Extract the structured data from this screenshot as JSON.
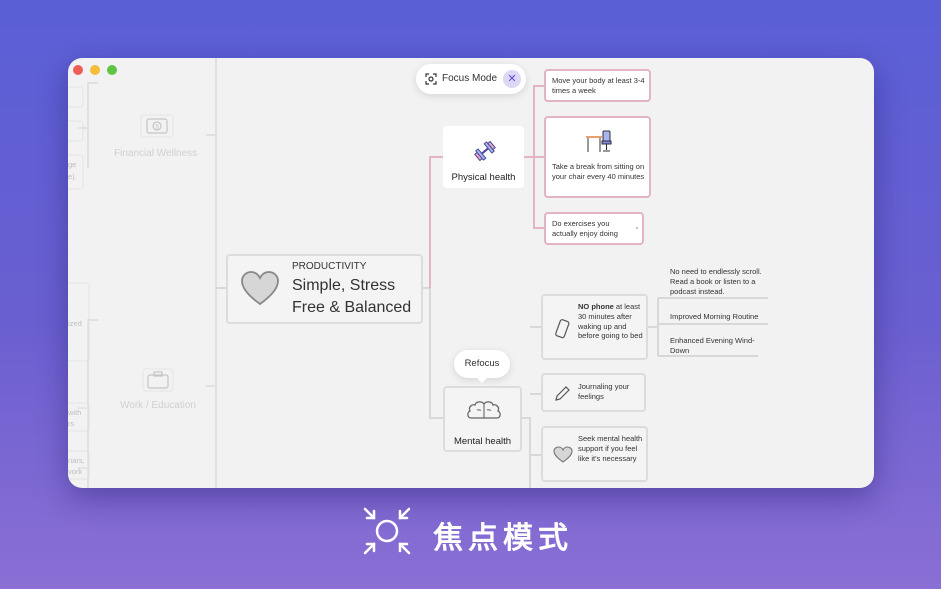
{
  "caption": {
    "text": "焦点模式",
    "icon": "focus-target-icon"
  },
  "focus_mode": {
    "label": "Focus Mode",
    "close": "✕",
    "icon": "focus-icon"
  },
  "refocus": {
    "label": "Refocus"
  },
  "left_branches": [
    {
      "label": "Financial Wellness",
      "icon": "money-icon"
    },
    {
      "label": "Work / Education",
      "icon": "briefcase-icon"
    }
  ],
  "left_snippets": [
    "ge",
    "e).",
    "ized",
    "with",
    "rs",
    "nars,",
    "vork"
  ],
  "central": {
    "category": "PRODUCTIVITY",
    "title_line1": "Simple, Stress",
    "title_line2": "Free & Balanced",
    "icon": "heart-icon"
  },
  "physical": {
    "label": "Physical health",
    "icon": "dumbbell-icon",
    "children": [
      {
        "text": "Move your body at least 3-4 times a week"
      },
      {
        "text": "Take a break from sitting on your chair every 40 minutes",
        "icon": "desk-chair-icon"
      },
      {
        "text": "Do exercises you actually enjoy doing",
        "icon": "note-icon"
      }
    ]
  },
  "mental": {
    "label": "Mental health",
    "icon": "brain-icon",
    "children": [
      {
        "bold": "NO phone",
        "text": " at least 30 minutes after waking up and before going to bed",
        "icon": "phone-icon"
      },
      {
        "text": "Journaling your feelings",
        "icon": "pencil-icon"
      },
      {
        "text": "Seek mental health support if you feel like it's necessary",
        "icon": "heart-icon"
      }
    ]
  },
  "phone_details": [
    "No need to endlessly scroll. Read a book or listen to a podcast instead.",
    "Improved Morning Routine",
    "Enhanced Evening Wind-Down"
  ]
}
